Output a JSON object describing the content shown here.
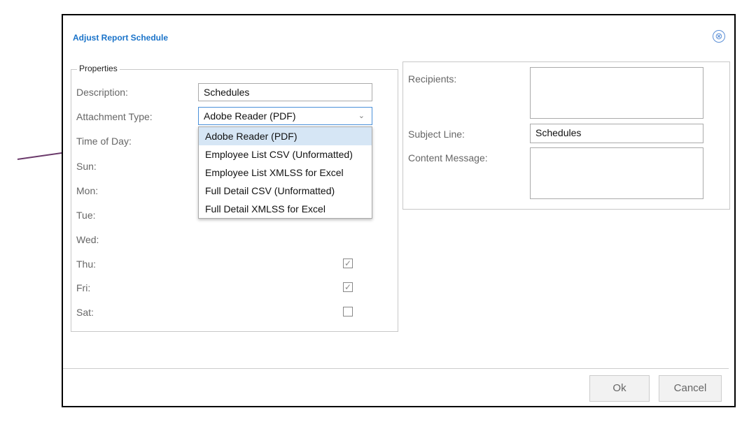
{
  "dialog": {
    "title": "Adjust Report Schedule",
    "close_icon": "⊗"
  },
  "properties": {
    "legend": "Properties",
    "description_label": "Description:",
    "description_value": "Schedules",
    "attachment_label": "Attachment Type:",
    "attachment_value": "Adobe Reader (PDF)",
    "time_label": "Time of Day:",
    "days": [
      {
        "label": "Sun:",
        "checked": null
      },
      {
        "label": "Mon:",
        "checked": null
      },
      {
        "label": "Tue:",
        "checked": null
      },
      {
        "label": "Wed:",
        "checked": null
      },
      {
        "label": "Thu:",
        "checked": true
      },
      {
        "label": "Fri:",
        "checked": true
      },
      {
        "label": "Sat:",
        "checked": false
      }
    ]
  },
  "dropdown": {
    "options": [
      "Adobe Reader (PDF)",
      "Employee List CSV (Unformatted)",
      "Employee List XMLSS for Excel",
      "Full Detail CSV (Unformatted)",
      "Full Detail XMLSS for Excel"
    ],
    "selected_index": 0
  },
  "email": {
    "recipients_label": "Recipients:",
    "recipients_value": "",
    "subject_label": "Subject Line:",
    "subject_value": "Schedules",
    "content_label": "Content Message:",
    "content_value": ""
  },
  "footer": {
    "ok_label": "Ok",
    "cancel_label": "Cancel"
  },
  "colors": {
    "title": "#1a73c9",
    "arrow": "#6b3a6b",
    "selected_option_bg": "#d6e6f5"
  },
  "icons": {
    "chevron": "chevron-down-icon",
    "check": "checkmark-icon"
  }
}
